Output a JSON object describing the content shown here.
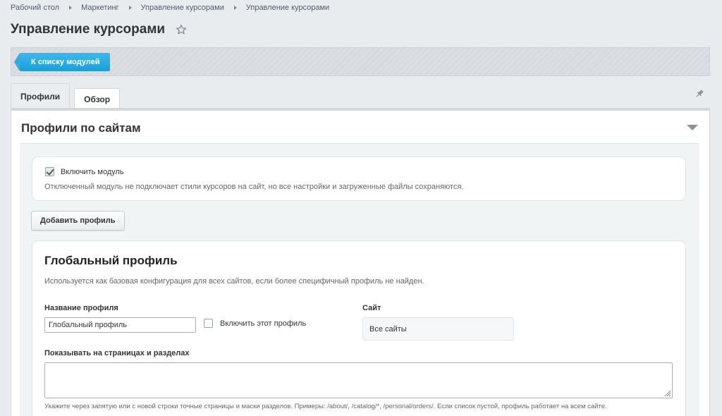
{
  "breadcrumb": [
    "Рабочий стол",
    "Маркетинг",
    "Управление курсорами",
    "Управление курсорами"
  ],
  "page": {
    "title": "Управление курсорами"
  },
  "toolbar": {
    "back_label": "К списку модулей"
  },
  "tabs": [
    {
      "label": "Профили",
      "active": true
    },
    {
      "label": "Обзор",
      "active": false
    }
  ],
  "section": {
    "title": "Профили по сайтам"
  },
  "module": {
    "enable_label": "Включить модуль",
    "enabled": true,
    "hint": "Отключенный модуль не подключает стили курсоров на сайт, но все настройки и загруженные файлы сохраняются."
  },
  "add_profile_label": "Добавить профиль",
  "profile": {
    "title": "Глобальный профиль",
    "description": "Используется как базовая конфигурация для всех сайтов, если более специфичный профиль не найден.",
    "name_label": "Название профиля",
    "name_value": "Глобальный профиль",
    "enable_label": "Включить этот профиль",
    "enabled": false,
    "site_label": "Сайт",
    "site_value": "Все сайты",
    "pages_label": "Показывать на страницах и разделах",
    "pages_value": "",
    "pages_hint": "Укажите через запятую или с новой строки точные страницы и маски разделов. Примеры: /about/, /catalog/*, /personal/orders/. Если список пустой, профиль работает на всем сайте."
  },
  "colors": {
    "accent": "#1a9fd8",
    "background": "#e8ecef"
  },
  "icons": [
    "star-icon",
    "pin-icon",
    "chevron-down-icon",
    "resize-icon"
  ]
}
